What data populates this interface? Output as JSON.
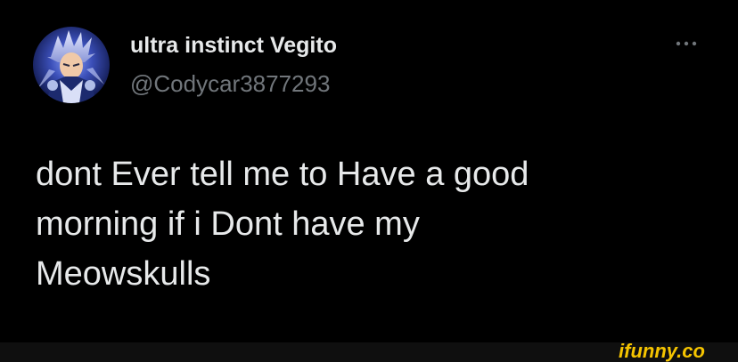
{
  "tweet": {
    "display_name": "ultra instinct Vegito",
    "handle": "@Codycar3877293",
    "text_lines": [
      "dont Ever tell me to Have a good",
      "morning if i Dont have my",
      "Meowskulls"
    ],
    "avatar_icon": "anime-character-avatar-icon",
    "more_icon": "more-options-icon"
  },
  "watermark": {
    "text": "ifunny.co",
    "color": "#f5c400"
  },
  "colors": {
    "background": "#000000",
    "primary_text": "#e7e9ea",
    "secondary_text": "#71767b"
  }
}
